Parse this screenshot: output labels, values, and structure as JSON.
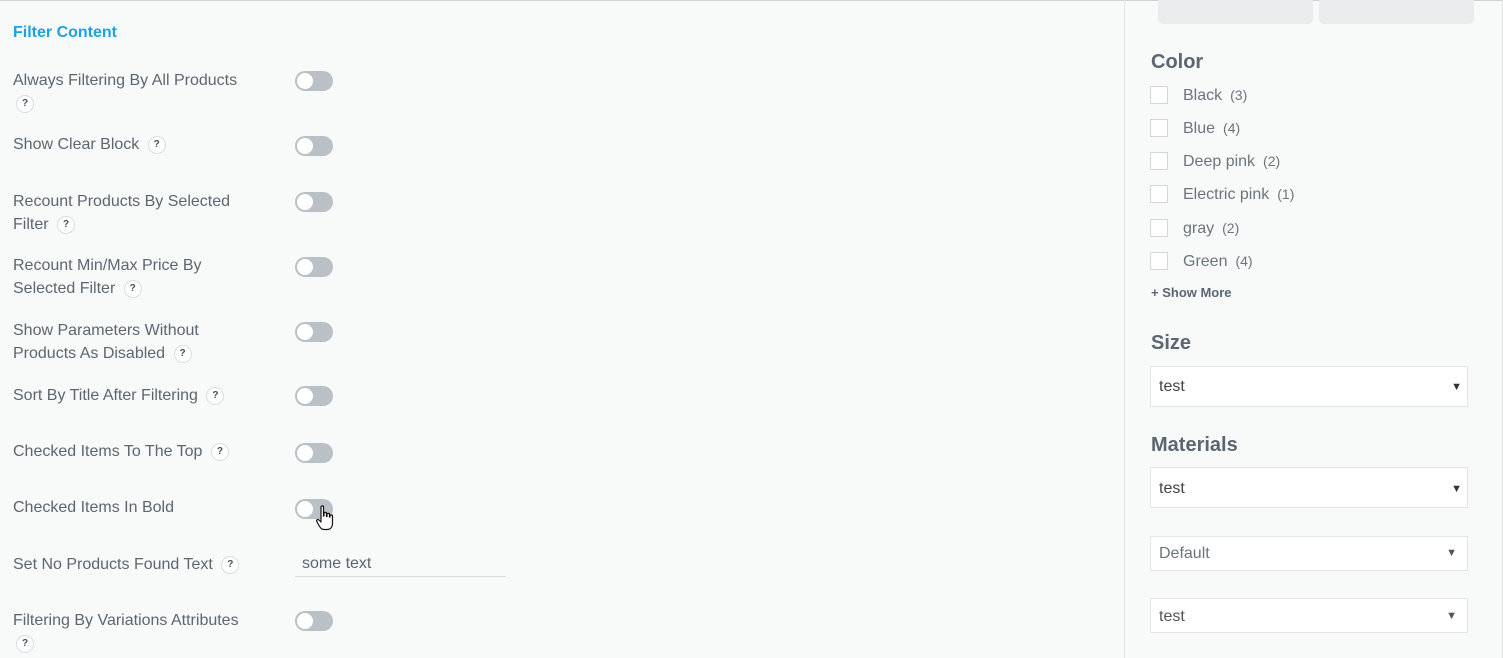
{
  "left": {
    "section_title": "Filter Content",
    "options": [
      {
        "label": "Always Filtering By All Products",
        "help": "?",
        "enabled": false
      },
      {
        "label": "Show Clear Block",
        "help": "?",
        "enabled": false
      },
      {
        "label": "Recount Products By Selected Filter",
        "help": "?",
        "enabled": false
      },
      {
        "label": "Recount Min/Max Price By Selected Filter",
        "help": "?",
        "enabled": false
      },
      {
        "label": "Show Parameters Without Products As Disabled",
        "help": "?",
        "enabled": false
      },
      {
        "label": "Sort By Title After Filtering",
        "help": "?",
        "enabled": false
      },
      {
        "label": "Checked Items To The Top",
        "help": "?",
        "enabled": false
      },
      {
        "label": "Checked Items In Bold",
        "enabled": false
      },
      {
        "label": "Set No Products Found Text",
        "help": "?",
        "value": "some text"
      },
      {
        "label": "Filtering By Variations Attributes",
        "help": "?",
        "enabled": false
      }
    ]
  },
  "right": {
    "color": {
      "heading": "Color",
      "items": [
        {
          "name": "Black",
          "count": "(3)"
        },
        {
          "name": "Blue",
          "count": "(4)"
        },
        {
          "name": "Deep pink",
          "count": "(2)"
        },
        {
          "name": "Electric pink",
          "count": "(1)"
        },
        {
          "name": "gray",
          "count": "(2)"
        },
        {
          "name": "Green",
          "count": "(4)"
        }
      ],
      "show_more": "+ Show More"
    },
    "size": {
      "heading": "Size",
      "selected": "test"
    },
    "materials": {
      "heading": "Materials",
      "selected": "test"
    },
    "extra_selects": [
      {
        "selected": "Default"
      },
      {
        "selected": "test"
      }
    ]
  }
}
